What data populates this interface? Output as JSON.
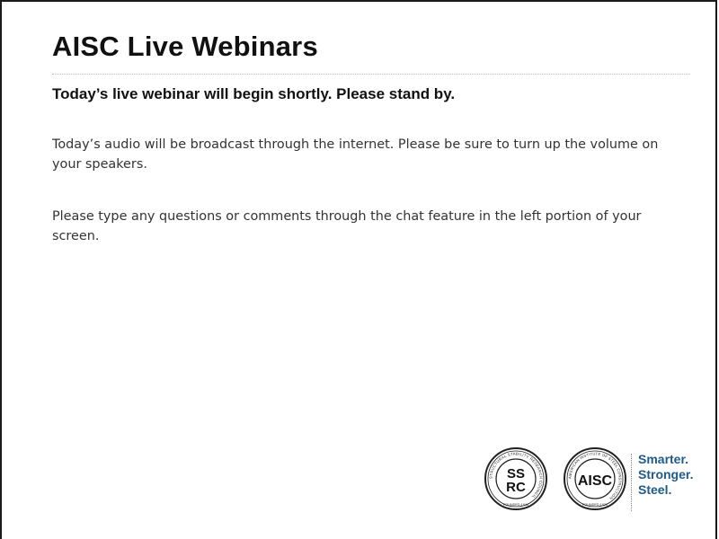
{
  "slide": {
    "title": "AISC Live Webinars",
    "subtitle": "Today’s live webinar will begin shortly.  Please stand by.",
    "paragraphs": [
      "Today’s audio will be broadcast through the internet.  Please be sure to turn up the volume on your speakers.",
      "Please type any questions or comments through the chat feature in the left portion of your screen."
    ]
  },
  "logos": {
    "ssrc": {
      "letters_top": "SS",
      "letters_bottom": "RC",
      "ring_text": "STRUCTURAL STABILITY RESEARCH COUNCIL",
      "founded": "FOUNDED 1944"
    },
    "aisc": {
      "letters": "AISC",
      "ring_text": "AMERICAN INSTITUTE OF STEEL CONSTRUCTION",
      "founded": "FOUNDED 1921"
    },
    "tagline": [
      "Smarter.",
      "Stronger.",
      "Steel."
    ]
  },
  "colors": {
    "tagline": "#1f5a8c",
    "text": "#333333",
    "title": "#111111"
  }
}
